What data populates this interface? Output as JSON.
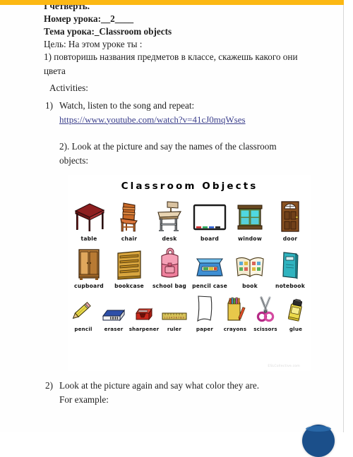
{
  "document": {
    "quarter": "I четверть.",
    "lesson_number": "Номер урока:__2____",
    "lesson_topic": "Тема урока:_Classroom objects",
    "aim_label": "Цель: На этом уроке ты :",
    "aim_item_1": "1) повторишь названия предметов в классе, скажешь какого они цвета",
    "activities_label": "Activities:",
    "activity_1": {
      "marker": "1)",
      "text": "Watch, listen to the song and repeat:",
      "link": "https://www.youtube.com/watch?v=41cJ0mqWses"
    },
    "activity_2": "2). Look at the picture and say the names of the classroom objects:",
    "activity_3": {
      "marker": "2)",
      "text": "Look at the picture again and say what color they are.",
      "sub": "For example:"
    }
  },
  "poster": {
    "title": "Classroom  Objects",
    "watermark": "ESLCollective.com",
    "rows": [
      {
        "items": [
          {
            "label": "table",
            "icon": "table-icon"
          },
          {
            "label": "chair",
            "icon": "chair-icon"
          },
          {
            "label": "desk",
            "icon": "desk-icon"
          },
          {
            "label": "board",
            "icon": "board-icon"
          },
          {
            "label": "window",
            "icon": "window-icon"
          },
          {
            "label": "door",
            "icon": "door-icon"
          }
        ]
      },
      {
        "items": [
          {
            "label": "cupboard",
            "icon": "cupboard-icon"
          },
          {
            "label": "bookcase",
            "icon": "bookcase-icon"
          },
          {
            "label": "school bag",
            "icon": "school-bag-icon"
          },
          {
            "label": "pencil case",
            "icon": "pencil-case-icon"
          },
          {
            "label": "book",
            "icon": "book-icon"
          },
          {
            "label": "notebook",
            "icon": "notebook-icon"
          }
        ]
      },
      {
        "items": [
          {
            "label": "pencil",
            "icon": "pencil-icon"
          },
          {
            "label": "eraser",
            "icon": "eraser-icon"
          },
          {
            "label": "sharpener",
            "icon": "sharpener-icon"
          },
          {
            "label": "ruler",
            "icon": "ruler-icon",
            "ruler_digits": "123456789"
          },
          {
            "label": "paper",
            "icon": "paper-icon"
          },
          {
            "label": "crayons",
            "icon": "crayons-icon"
          },
          {
            "label": "scissors",
            "icon": "scissors-icon"
          },
          {
            "label": "glue",
            "icon": "glue-icon"
          }
        ]
      }
    ]
  },
  "chrome": {
    "top_bar_color": "#fcb813",
    "fab_color": "#1b4f8a",
    "link_color": "#3b3f8c"
  }
}
